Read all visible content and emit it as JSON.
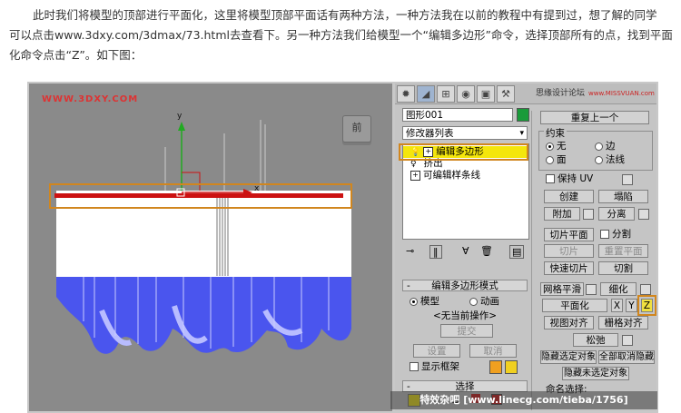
{
  "intro": {
    "line1": "此时我们将模型的顶部进行平面化，这里将模型顶部平面话有两种方法，一种方法我在以前的教程中有提到过，想了解的同学",
    "line2": "可以点击www.3dxy.com/3dmax/73.html去查看下。另一种方法我们给模型一个“编辑多边形”命令，选择顶部所有的点，找到平面",
    "line3": "化命令点击“Z”。如下图："
  },
  "viewport": {
    "watermark": "WWW.3DXY.COM",
    "viewcube_label": "前",
    "axis_x": "x",
    "axis_y": "y"
  },
  "panel": {
    "brand": "思缘设计论坛",
    "brand_url": "www.MISSVUAN.com",
    "object_name": "图形001",
    "object_color": "#1a9b3a",
    "modifier_list": "修改器列表",
    "stack": [
      "编辑多边形",
      "挤出",
      "可编辑样条线"
    ],
    "repeat_last": "重复上一个",
    "constraints": {
      "title": "约束",
      "none": "无",
      "edge": "边",
      "face": "面",
      "normal": "法线"
    },
    "keep_uv": "保持 UV",
    "create": "创建",
    "collapse": "塌陷",
    "attach": "附加",
    "detach": "分离",
    "slice_plane": "切片平面",
    "split": "分割",
    "slice": "切片",
    "reset_plane": "重置平面",
    "quickslice": "快速切片",
    "cut": "切割",
    "meshsmooth": "网格平滑",
    "tessellate": "细化",
    "make_planar": "平面化",
    "x": "X",
    "y": "Y",
    "z": "Z",
    "view_align": "视图对齐",
    "grid_align": "栅格对齐",
    "relax": "松弛",
    "hide_selected": "隐藏选定对象",
    "unhide_all": "全部取消隐藏",
    "hide_unselected": "隐藏未选定对象",
    "named_selections": "命名选择:",
    "edit_poly_mode": {
      "title": "编辑多边形模式",
      "model": "模型",
      "animate": "动画",
      "no_operation": "<无当前操作>",
      "commit": "提交",
      "settings": "设置",
      "cancel": "取消",
      "show_cage": "显示框架"
    },
    "selection": "选择",
    "minus": "-"
  },
  "caption": "特效杂吧 [www.linecg.com/tieba/1756]",
  "colors": {
    "highlight": "#d1861e",
    "stack_selected": "#f4e60c",
    "model_blue": "#4a55ee",
    "edge_red": "#cc1111",
    "gizmo_green": "#22aa22"
  }
}
